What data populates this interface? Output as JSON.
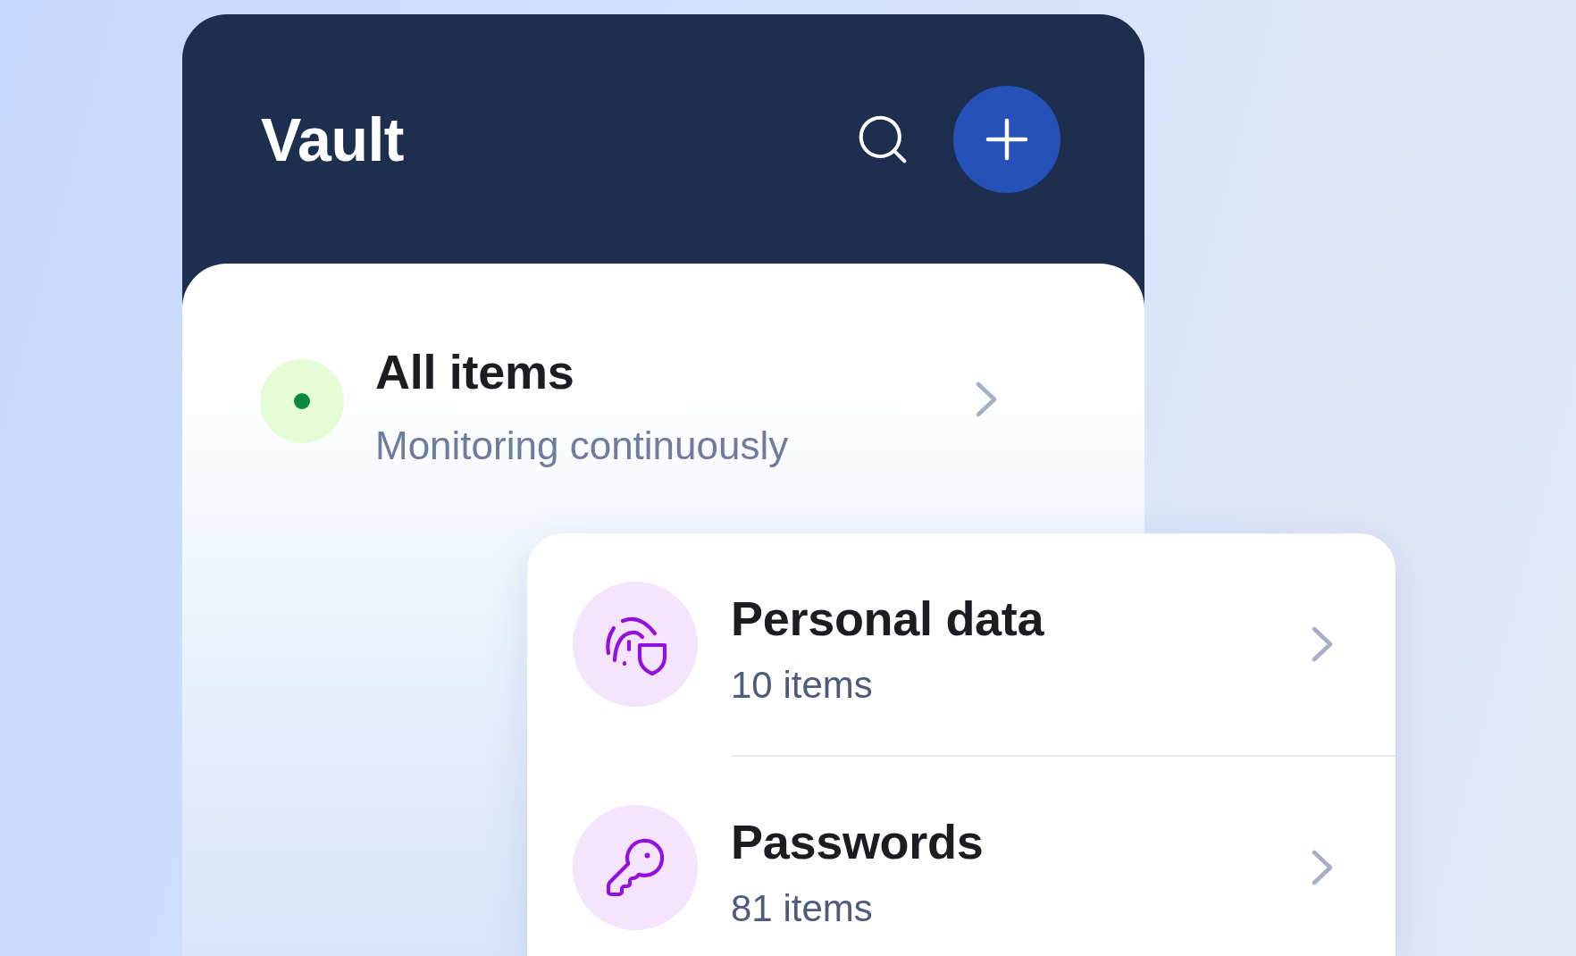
{
  "header": {
    "title": "Vault"
  },
  "overview": {
    "title": "All items",
    "subtitle": "Monitoring continuously"
  },
  "categories": [
    {
      "kind": "identity",
      "title": "Personal data",
      "count": "10 items"
    },
    {
      "kind": "password",
      "title": "Passwords",
      "count": "81 items"
    }
  ]
}
